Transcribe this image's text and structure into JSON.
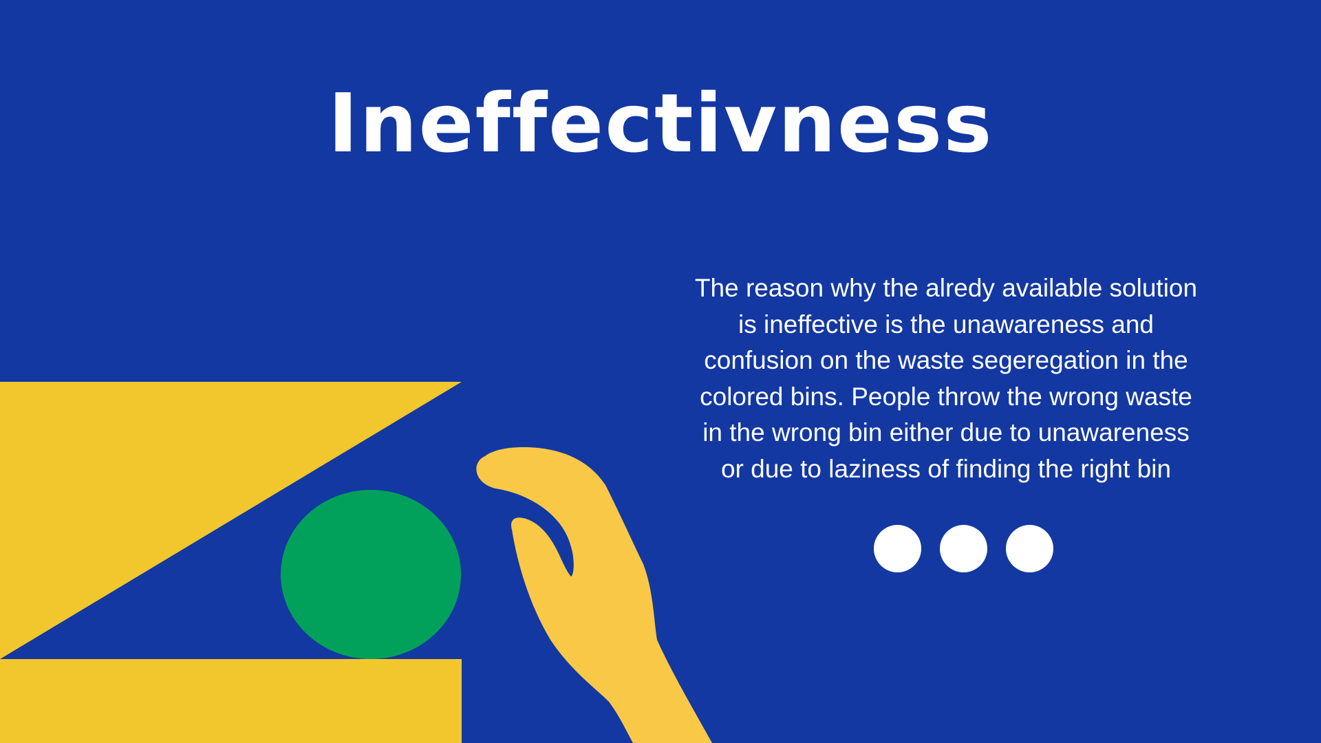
{
  "slide": {
    "title": "Ineffectivness",
    "body": "The reason why the alredy available solution is ineffective is the unawareness and confusion on the waste segeregation  in the colored bins. People throw the wrong waste in the wrong bin either due to unawareness or due to laziness of finding the right bin",
    "pagination_dot_count": 3
  },
  "colors": {
    "background": "#1338a2",
    "yellow_shapes": "#f2c72d",
    "hand": "#f9c846",
    "circle": "#02a15b",
    "text": "#ffffff"
  }
}
